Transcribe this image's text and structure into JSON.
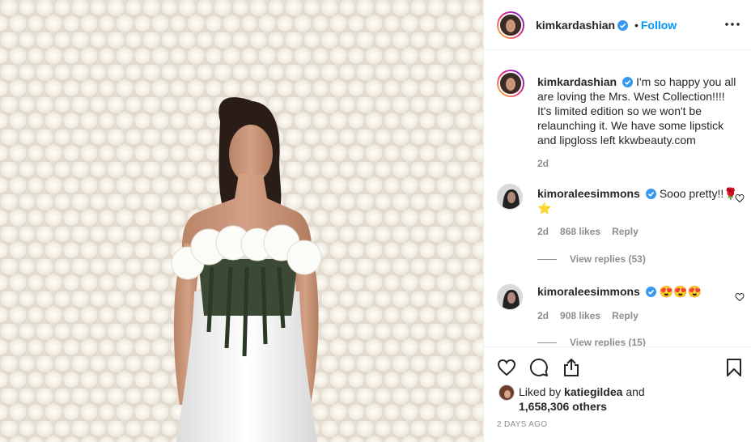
{
  "post": {
    "image_alt": "Woman in white strapless dress with white rose bodice in front of white flower wall"
  },
  "header": {
    "username": "kimkardashian",
    "separator": "•",
    "follow_label": "Follow",
    "more_icon": "more-horizontal-icon"
  },
  "caption": {
    "username": "kimkardashian",
    "text": "I'm so happy you all are loving the Mrs. West Collection!!!! It's limited edition so we won't be relaunching it. We have some lipstick and lipgloss left kkwbeauty.com",
    "age": "2d"
  },
  "comments": [
    {
      "username": "kimoraleesimmons",
      "text": "Sooo pretty!!🌹⭐",
      "age": "2d",
      "likes": "868 likes",
      "reply_label": "Reply",
      "view_replies": "View replies (53)"
    },
    {
      "username": "kimoraleesimmons",
      "text": "😍😍😍",
      "age": "2d",
      "likes": "908 likes",
      "reply_label": "Reply",
      "view_replies": "View replies (15)"
    }
  ],
  "actions": {
    "liked_prefix": "Liked by",
    "liked_user": "katiegildea",
    "liked_and": "and",
    "liked_count": "1,658,306 others",
    "timestamp": "2 DAYS AGO"
  },
  "colors": {
    "link_blue": "#0095f6",
    "muted": "#8e8e8e",
    "text": "#262626",
    "verified": "#3897f0"
  }
}
